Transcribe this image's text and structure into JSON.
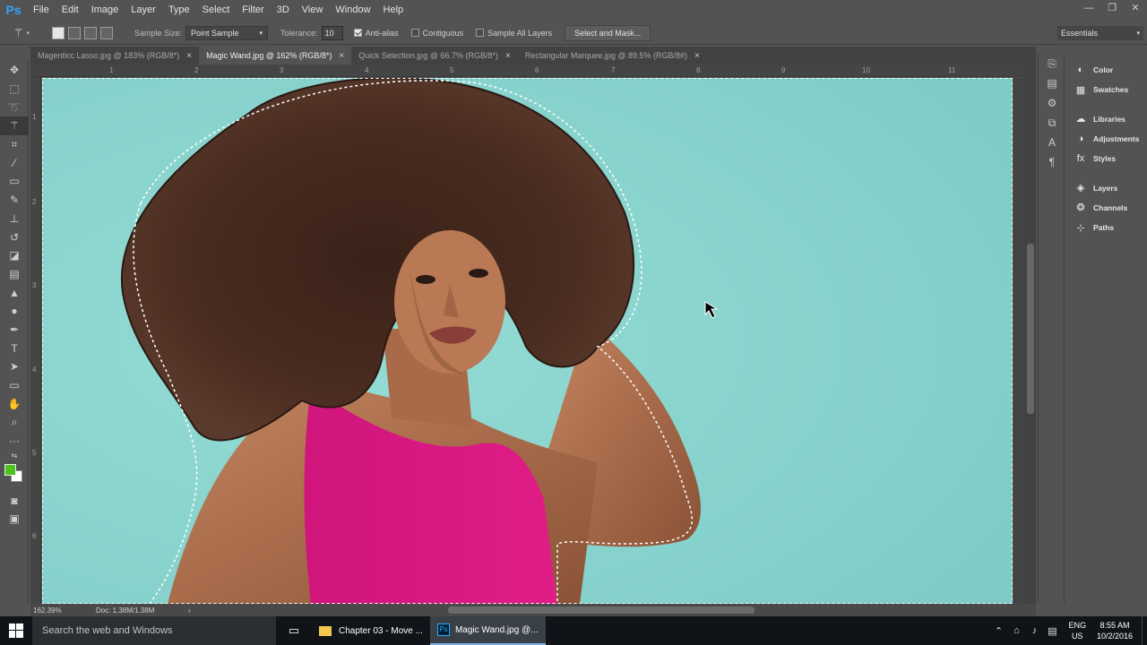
{
  "app": {
    "logo": "Ps"
  },
  "menu": [
    "File",
    "Edit",
    "Image",
    "Layer",
    "Type",
    "Select",
    "Filter",
    "3D",
    "View",
    "Window",
    "Help"
  ],
  "window_controls": {
    "minimize": "—",
    "restore": "❐",
    "close": "✕"
  },
  "options": {
    "sample_size_label": "Sample Size:",
    "sample_size_value": "Point Sample",
    "tolerance_label": "Tolerance:",
    "tolerance_value": "10",
    "anti_alias_label": "Anti-alias",
    "anti_alias_checked": true,
    "contiguous_label": "Contiguous",
    "contiguous_checked": false,
    "sample_all_layers_label": "Sample All Layers",
    "sample_all_layers_checked": false,
    "select_and_mask_label": "Select and Mask..."
  },
  "workspace": {
    "label": "Essentials"
  },
  "tabs": [
    {
      "label": "Magenticc Lasso.jpg @ 183% (RGB/8*)",
      "close": "×",
      "active": false
    },
    {
      "label": "Magic Wand.jpg @ 162% (RGB/8*)",
      "close": "×",
      "active": true
    },
    {
      "label": "Quick Selection.jpg @ 66.7% (RGB/8*)",
      "close": "×",
      "active": false
    },
    {
      "label": "Rectangular Marquee.jpg @ 89.5% (RGB/8#)",
      "close": "×",
      "active": false
    }
  ],
  "ruler": {
    "top": [
      "1",
      "2",
      "3",
      "4",
      "5",
      "6",
      "7",
      "8",
      "9",
      "10",
      "11"
    ],
    "left": [
      "1",
      "2",
      "3",
      "4",
      "5",
      "6"
    ]
  },
  "status": {
    "zoom": "162.39%",
    "doc": "Doc: 1.38M/1.38M",
    "arrow": "›"
  },
  "panels": [
    {
      "label": "Color",
      "icon": "color-icon"
    },
    {
      "label": "Swatches",
      "icon": "swatches-icon"
    },
    {
      "label": "Libraries",
      "icon": "libraries-icon"
    },
    {
      "label": "Adjustments",
      "icon": "adjustments-icon"
    },
    {
      "label": "Styles",
      "icon": "styles-icon"
    },
    {
      "label": "Layers",
      "icon": "layers-icon"
    },
    {
      "label": "Channels",
      "icon": "channels-icon"
    },
    {
      "label": "Paths",
      "icon": "paths-icon"
    }
  ],
  "colors": {
    "foreground": "#4cc21d",
    "background": "#ffffff",
    "canvas_bg": "#85d0ca",
    "accent": "#2fa3ff"
  },
  "taskbar": {
    "search_placeholder": "Search the web and Windows",
    "apps": [
      {
        "label": "Chapter 03 - Move ...",
        "icon": "folder-icon",
        "active": false
      },
      {
        "label": "Magic Wand.jpg @...",
        "icon": "photoshop-icon",
        "active": true
      }
    ],
    "lang_top": "ENG",
    "lang_bottom": "US",
    "time": "8:55 AM",
    "date": "10/2/2016"
  }
}
